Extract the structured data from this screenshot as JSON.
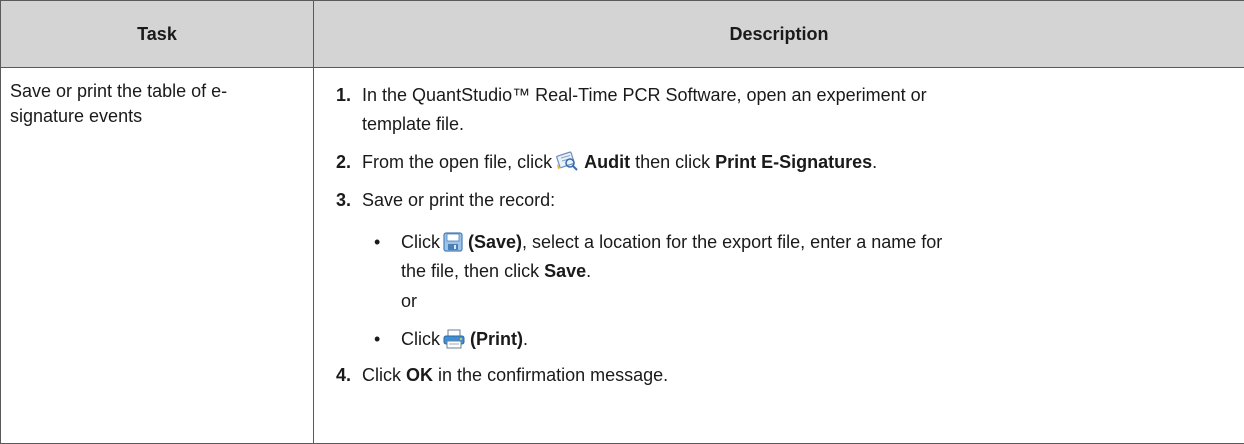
{
  "table": {
    "headers": {
      "task": "Task",
      "description": "Description"
    },
    "task_text": "Save or print the table of e-signature events"
  },
  "steps": {
    "s1": {
      "num": "1.",
      "line1": "In the QuantStudio™ Real-Time PCR Software, open an experiment or",
      "line2": "template file."
    },
    "s2": {
      "num": "2.",
      "prefix": "From the open file, click",
      "audit_icon": "audit-icon",
      "audit_label": "Audit",
      "mid": "then click",
      "print_esig": "Print E-Signatures",
      "suffix": "."
    },
    "s3": {
      "num": "3.",
      "text": "Save or print the record:"
    },
    "b1": {
      "bullet": "•",
      "click": "Click",
      "save_icon": "save-disk-icon",
      "save_label": "(Save)",
      "rest1": ", select a location for the export file, enter a name for",
      "line2_prefix": "the file, then click",
      "save_btn": "Save",
      "line2_suffix": "."
    },
    "or": "or",
    "b2": {
      "bullet": "•",
      "click": "Click",
      "print_icon": "printer-icon",
      "print_label": "(Print)",
      "suffix": "."
    },
    "s4": {
      "num": "4.",
      "prefix": "Click",
      "ok": "OK",
      "suffix": "in the confirmation message."
    }
  }
}
